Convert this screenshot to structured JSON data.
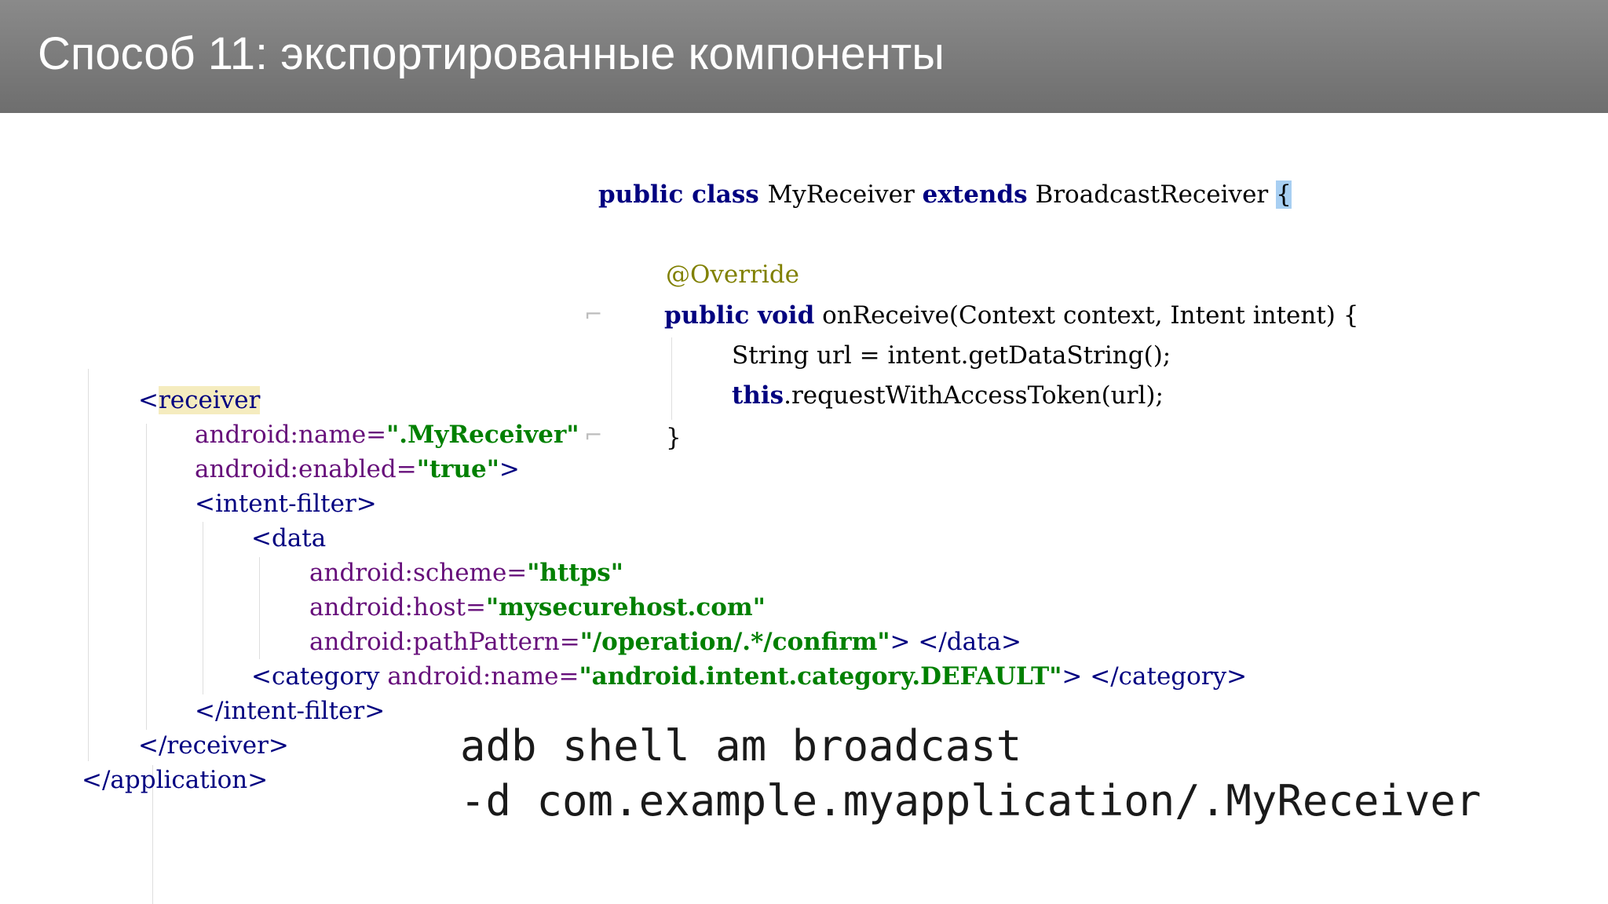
{
  "slide": {
    "title": "Способ 11: экспортированные компоненты"
  },
  "java_code": {
    "l1_public": "public",
    "l1_class": " class ",
    "l1_name": "MyReceiver ",
    "l1_extends": "extends",
    "l1_super": " BroadcastReceiver ",
    "l1_brace": "{",
    "l2_annotation": "@Override",
    "l3_public": "public",
    "l3_void": " void",
    "l3_signature": " onReceive(Context context, Intent intent) {",
    "l4": "String url = intent.getDataString();",
    "l5_this": "this",
    "l5_rest": ".requestWithAccessToken(url);",
    "l6": "}"
  },
  "xml_code": {
    "receiver_open_lt": "<",
    "receiver_open_tag": "receiver",
    "name_attr": "android:name=",
    "name_val": "\".MyReceiver\"",
    "enabled_attr": "android:enabled=",
    "enabled_val": "\"true\"",
    "enabled_close": ">",
    "intent_filter_open": "<intent-filter>",
    "data_open": "<data",
    "scheme_attr": "android:scheme=",
    "scheme_val": "\"https\"",
    "host_attr": "android:host=",
    "host_val": "\"mysecurehost.com\"",
    "path_attr": "android:pathPattern=",
    "path_val": "\"/operation/.*/confirm\"",
    "path_close": "> </data>",
    "category_open": "<category ",
    "category_attr": "android:name=",
    "category_val": "\"android.intent.category.DEFAULT\"",
    "category_close": "> </category>",
    "intent_filter_close": "</intent-filter>",
    "receiver_close": "</receiver>",
    "application_close": "</application>"
  },
  "adb_command": {
    "line1": "adb shell am broadcast",
    "line2": "-d com.example.myapplication/.MyReceiver"
  }
}
